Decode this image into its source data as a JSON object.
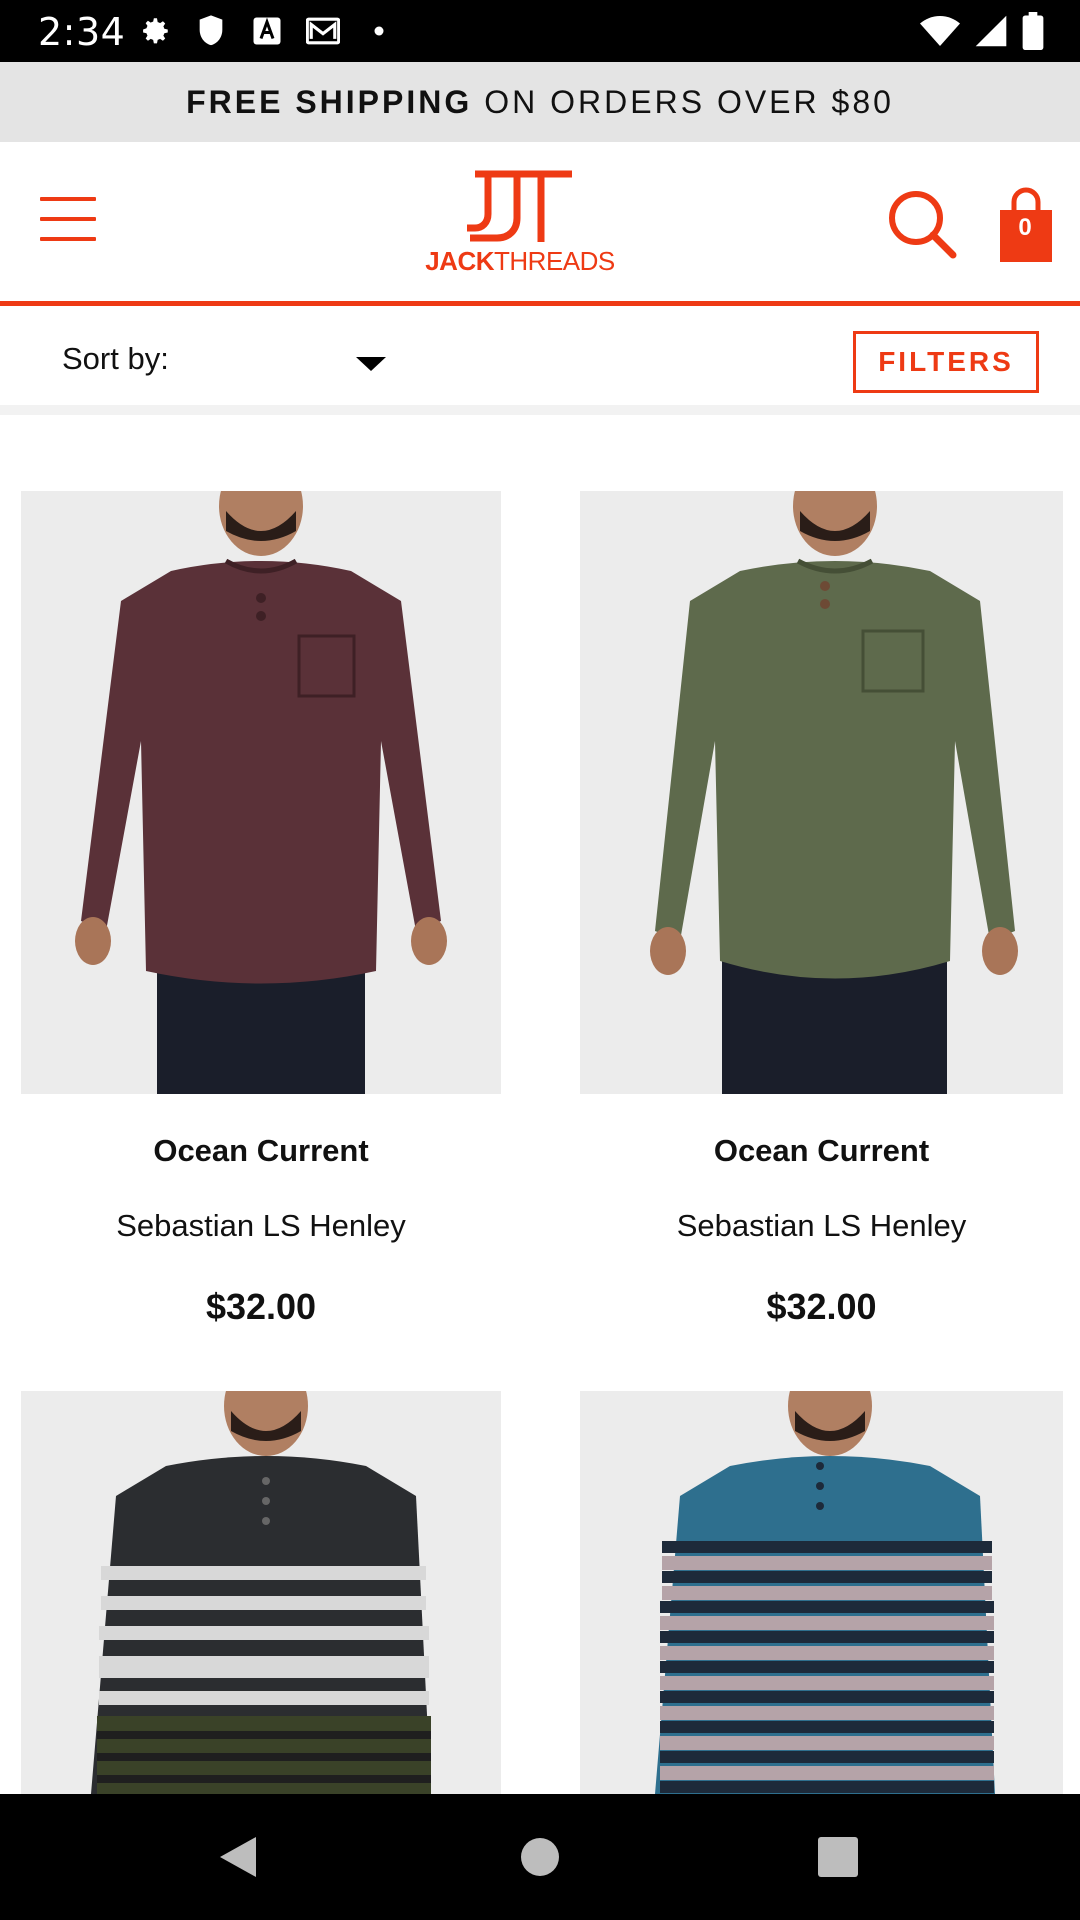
{
  "status_bar": {
    "time": "2:34",
    "left_icons": [
      "settings-icon",
      "shield-icon",
      "font-icon",
      "gmail-icon",
      "dot-icon"
    ],
    "right_icons": [
      "wifi-icon",
      "signal-icon",
      "battery-icon"
    ]
  },
  "promo": {
    "bold_text": "FREE SHIPPING",
    "rest_text": "ON ORDERS OVER $80"
  },
  "header": {
    "logo_mark": "JT",
    "logo_word_bold": "JACK",
    "logo_word_rest": "THREADS",
    "cart_count": "0"
  },
  "sortbar": {
    "sort_label": "Sort by:",
    "sort_value": "",
    "filters_label": "FILTERS"
  },
  "products": [
    {
      "brand": "Ocean Current",
      "name": "Sebastian LS Henley",
      "price": "$32.00",
      "color": "#5a3138"
    },
    {
      "brand": "Ocean Current",
      "name": "Sebastian LS Henley",
      "price": "$32.00",
      "color": "#5e6a4c"
    },
    {
      "brand": "",
      "name": "",
      "price": "",
      "color": "#2b2d30"
    },
    {
      "brand": "",
      "name": "",
      "price": "",
      "color": "#2e6f8e"
    }
  ],
  "colors": {
    "accent": "#ee3a14",
    "promo_bg": "#e4e4e4"
  }
}
